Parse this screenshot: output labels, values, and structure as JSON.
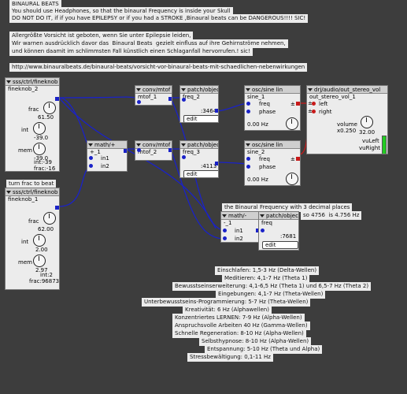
{
  "notes": {
    "n1": "BINAURAL BEATS",
    "n2": "You should use Headphones, so that the binaural Frequency is inside your Skull",
    "n3": "DO NOT DO IT, if if you have EPILEPSY or if you had a STROKE ,Binaural beats can be DANGEROUS!!!! SIC!",
    "n4": "Allergrößte Vorsicht ist geboten, wenn Sie unter Epilepsie leiden,",
    "n5": "Wir warnen ausdrücklich davor das  Binaural Beats  gezielt einfluss auf ihre Gehirnströme nehmen,",
    "n6": "und können daamit im schlimmsten Fall künstlich einen Schlaganfall hervorrufen.! sic!",
    "url": "http://www.binauralbeats.de/binaural-beats/vorsicht-vor-binaural-beats-mit-schaedlichen-nebenwirkungen",
    "turn": "turn frac to beat",
    "freqnote": "the Binaural Frequency with 3 decimal places",
    "eq": "so 4756  is 4.756 Hz"
  },
  "fk1": {
    "type": "sss/ctrl/fineknob",
    "name": "fineknob_2",
    "frac": "frac",
    "frac_val": "61.50",
    "int": "int",
    "int_val": "-39.0",
    "mem": "mem",
    "mem_val": "-39.0",
    "int_out": "int:-39",
    "frac_out": "frac:-16"
  },
  "fk2": {
    "type": "sss/ctrl/fineknob",
    "name": "fineknob_1",
    "frac": "frac",
    "frac_val": "62.00",
    "int": "int",
    "int_val": "2.00",
    "mem": "mem",
    "mem_val": "2.97",
    "int_out": "int:2",
    "frac_out": "frac:968734"
  },
  "mtof1": {
    "type": "conv/mtof",
    "name": "mtof_1"
  },
  "mtof2": {
    "type": "conv/mtof",
    "name": "mtof_2"
  },
  "add": {
    "type": "math/+",
    "name": "+_1",
    "in1": "in1",
    "in2": "in2"
  },
  "pf2": {
    "type": "patch/object",
    "name": "freq_2",
    "val": ":3464",
    "edit": "edit"
  },
  "pf3": {
    "type": "patch/object",
    "name": "freq_3",
    "val": ":4113",
    "edit": "edit"
  },
  "sine1": {
    "type": "osc/sine lin",
    "name": "sine_1",
    "freq": "freq",
    "phase": "phase",
    "hz": "0.00 Hz"
  },
  "sine2": {
    "type": "osc/sine lin",
    "name": "sine_2",
    "freq": "freq",
    "phase": "phase",
    "hz": "0.00 Hz"
  },
  "sub": {
    "type": "math/-",
    "name": "-_1",
    "in1": "in1",
    "in2": "in2"
  },
  "pfreq": {
    "type": "patch/object",
    "name": "freq",
    "val": ":7681",
    "edit": "edit"
  },
  "out": {
    "type": "drj/audio/out_stereo_vol",
    "name": "out_stereo_vol_1",
    "left": "left",
    "right": "right",
    "volume": "volume",
    "vol_val": "x0.250",
    "knob_val": "32.00",
    "vuleft": "vuLeft",
    "vuright": "vuRight"
  },
  "waves": [
    "Einschlafen: 1,5-3 Hz (Delta-Wellen)",
    "Meditieren: 4,1-7 Hz (Theta 1)",
    "Bewusstseinserweiterung: 4,1-6,5 Hz (Theta 1) und 6,5-7 Hz (Theta 2)",
    "Eingebungen: 4,1-7 Hz (Theta-Wellen)",
    "Unterbewusstseins-Programmierung: 5-7 Hz (Theta-Wellen)",
    "Kreativität: 6 Hz (Alphawellen)",
    "Konzentriertes LERNEN: 7-9 Hz (Alpha-Wellen)",
    "Anspruchsvolle Arbeiten 40 Hz (Gamma-Wellen)",
    "Schnelle Regeneration: 8-10 Hz (Alpha-Wellen)",
    "Selbsthypnose: 8-10 Hz (Alpha-Wellen)",
    "Entspannung: 5-10 Hz (Theta und Alpha)",
    "Stressbewältigung: 0,1-11 Hz"
  ]
}
